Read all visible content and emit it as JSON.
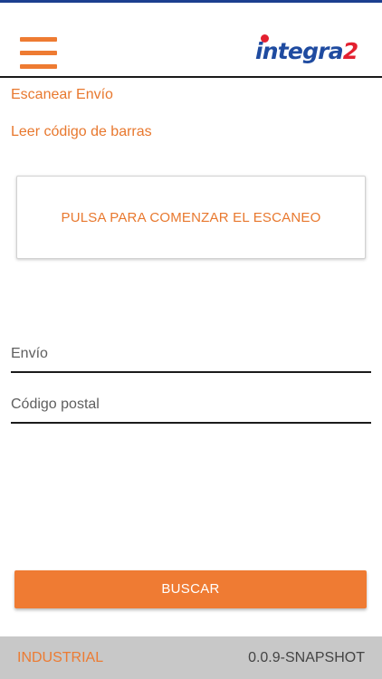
{
  "header": {
    "logo_text": "integra",
    "logo_number": "2",
    "menu_icon": "hamburger-menu-icon"
  },
  "main": {
    "title": "Escanear Envío",
    "subtitle": "Leer código de barras",
    "scan_button_label": "PULSA PARA COMENZAR EL ESCANEO",
    "fields": {
      "shipment_placeholder": "Envío",
      "postal_code_placeholder": "Código postal"
    },
    "search_button_label": "BUSCAR"
  },
  "footer": {
    "environment": "INDUSTRIAL",
    "version": "0.0.9-SNAPSHOT"
  },
  "colors": {
    "accent": "#ee7b32",
    "brand_blue": "#1f4ba0",
    "brand_red": "#e3202f",
    "footer_bg": "#c8c8c8"
  }
}
